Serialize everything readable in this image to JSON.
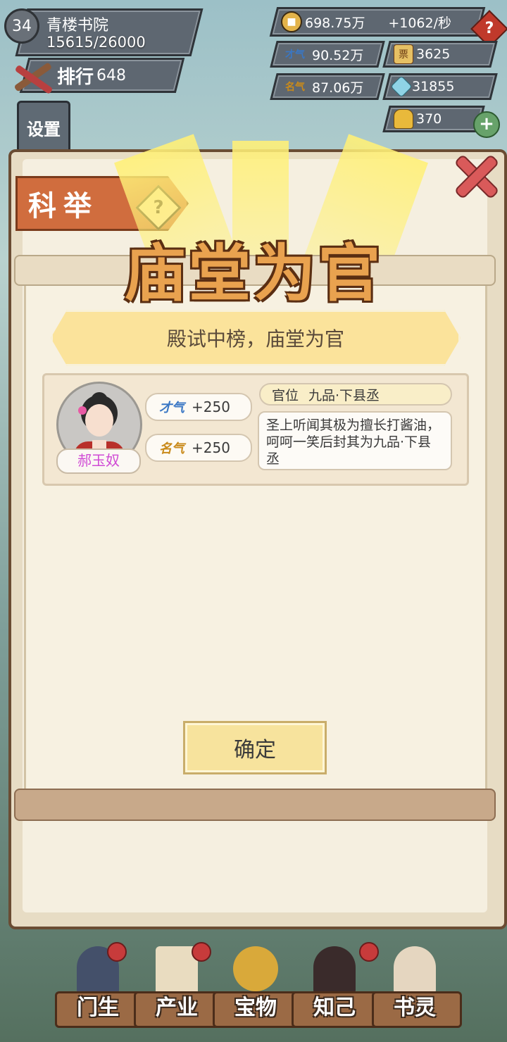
{
  "player": {
    "level": "34",
    "name": "青楼书院",
    "exp": "15615/26000",
    "rank_label": "排行",
    "rank_value": "648"
  },
  "resources": {
    "copper": "698.75万",
    "copper_rate": "+1062/秒",
    "talent": "90.52万",
    "fame": "87.06万",
    "gold_ticket": "3625",
    "diamond": "31855",
    "ingot": "370"
  },
  "icons": {
    "talent": "才气",
    "fame": "名气",
    "ticket": "金票"
  },
  "settings_label": "设置",
  "panel": {
    "tab_label": "科举",
    "help_glyph": "?",
    "title": "庙堂为官",
    "banner": "殿试中榜，庙堂为官",
    "confirm": "确定",
    "close_glyph": "✕"
  },
  "result": {
    "student_name": "郝玉奴",
    "talent_gain": "+250",
    "fame_gain": "+250",
    "rank_label": "官位",
    "rank_value": "九品·下县丞",
    "description": "圣上听闻其极为擅长打酱油，呵呵一笑后封其为九品·下县丞"
  },
  "nav": [
    {
      "label": "门生"
    },
    {
      "label": "产业"
    },
    {
      "label": "宝物"
    },
    {
      "label": "知己"
    },
    {
      "label": "书灵"
    }
  ],
  "colors": {
    "accent_orange": "#d06d3e",
    "talent_blue": "#3a77c4",
    "fame_gold": "#c98a1a",
    "name_pink": "#d04bd5"
  }
}
